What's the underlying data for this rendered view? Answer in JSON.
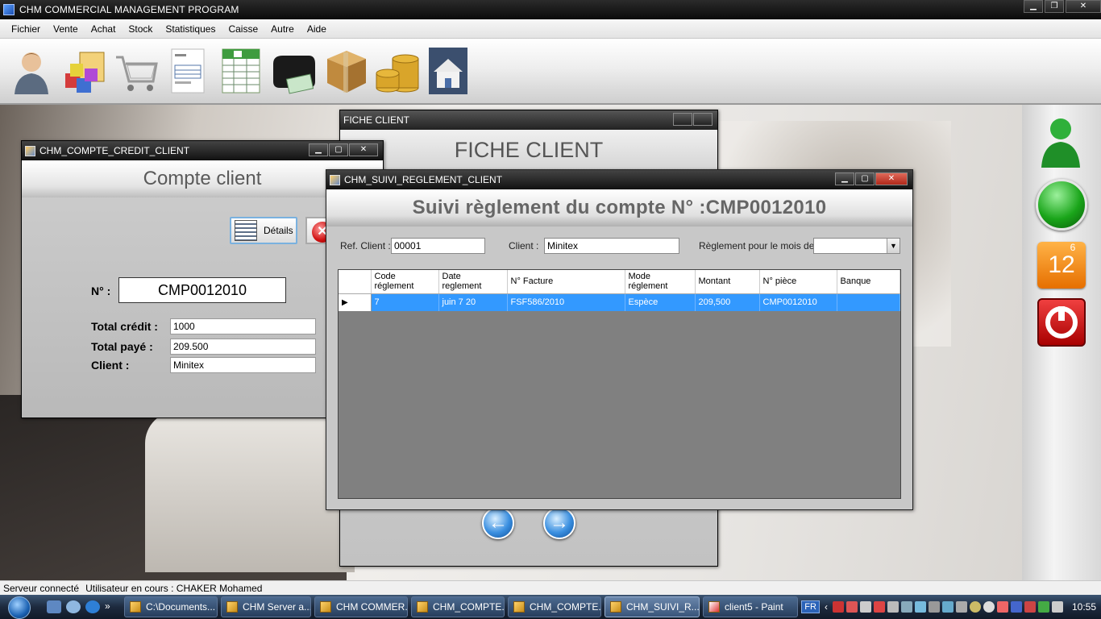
{
  "app": {
    "title": "CHM COMMERCIAL MANAGEMENT PROGRAM"
  },
  "menu": [
    "Fichier",
    "Vente",
    "Achat",
    "Stock",
    "Statistiques",
    "Caisse",
    "Autre",
    "Aide"
  ],
  "toolbar_icons": [
    "user-icon",
    "products-icon",
    "cart-icon",
    "invoice-icon",
    "spreadsheet-icon",
    "wallet-icon",
    "box-icon",
    "coins-icon",
    "home-icon"
  ],
  "fiche_client": {
    "title": "FICHE CLIENT",
    "heading": "FICHE CLIENT"
  },
  "compte_window": {
    "title": "CHM_COMPTE_CREDIT_CLIENT",
    "heading": "Compte client",
    "details_button": "Détails",
    "num_label": "N° :",
    "num_value": "CMP0012010",
    "total_credit_label": "Total crédit :",
    "total_credit_value": "1000",
    "total_paye_label": "Total payé :",
    "total_paye_value": "209.500",
    "client_label": "Client :",
    "client_value": "Minitex"
  },
  "suivi_window": {
    "title": "CHM_SUIVI_REGLEMENT_CLIENT",
    "heading": "Suivi règlement du compte N° :CMP0012010",
    "ref_label": "Ref. Client :",
    "ref_value": "00001",
    "client_label": "Client :",
    "client_value": "Minitex",
    "mois_label": "Règlement pour le mois de :",
    "mois_value": "",
    "columns": [
      "Code\nréglement",
      "Date\nreglement",
      "N° Facture",
      "Mode\nréglement",
      "Montant",
      "N° pièce",
      "Banque"
    ],
    "rows": [
      [
        "7",
        "juin  7 20",
        "FSF586/2010",
        "Espèce",
        "209,500",
        "CMP0012010",
        ""
      ]
    ]
  },
  "right_panel": {
    "calendar_month": "6",
    "calendar_day": "12"
  },
  "statusbar": {
    "server": "Serveur connecté",
    "user": "Utilisateur en cours : CHAKER Mohamed"
  },
  "taskbar": {
    "tasks": [
      "C:\\Documents...",
      "CHM Server a...",
      "CHM COMMER...",
      "CHM_COMPTE...",
      "CHM_COMPTE...",
      "CHM_SUIVI_R...",
      "client5 - Paint"
    ],
    "active_index": 5,
    "lang": "FR",
    "clock": "10:55"
  },
  "colors": {
    "selection": "#3399ff",
    "titlebar": "#111111"
  }
}
